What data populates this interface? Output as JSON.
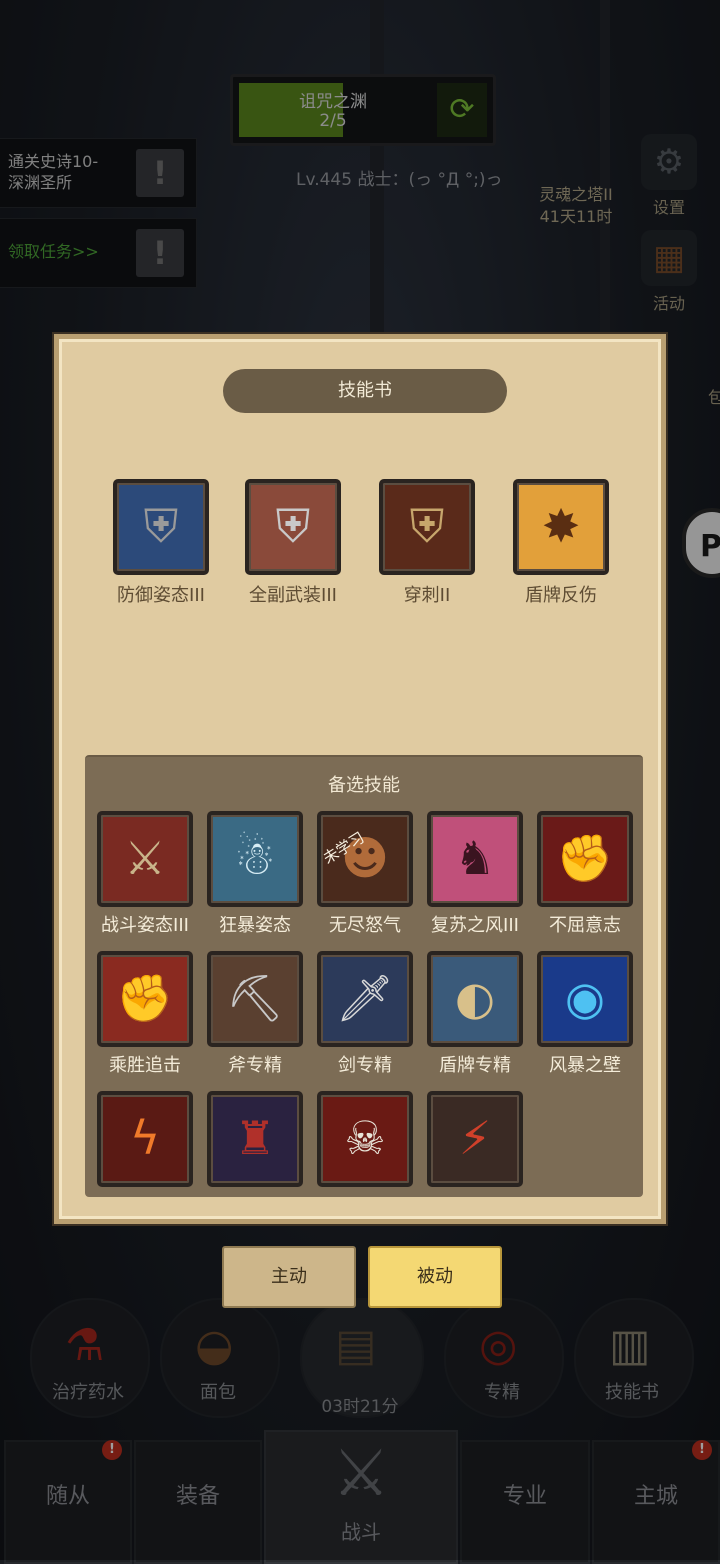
{
  "background": {
    "progress": {
      "title": "诅咒之渊",
      "count": "2/5",
      "fill_fraction": 0.42
    },
    "quests": [
      {
        "text_line1": "通关史诗10-",
        "text_line2": "深渊圣所"
      },
      {
        "text_line1": "领取任务>>",
        "text_line2": ""
      }
    ],
    "player_info": "Lv.445 战士：(っ °Д °;)っ",
    "tower": {
      "line1": "灵魂之塔II",
      "line2": "41天11时"
    },
    "side_buttons": {
      "settings": "设置",
      "activity": "活动",
      "bag_partial": "包"
    },
    "edge_badge": "P"
  },
  "panel": {
    "title": "技能书",
    "equipped": [
      {
        "name": "防御姿态III",
        "icon": "grey-shield-icon"
      },
      {
        "name": "全副武装III",
        "icon": "split-shield-icon"
      },
      {
        "name": "穿刺II",
        "icon": "pierced-shield-icon"
      },
      {
        "name": "盾牌反伤",
        "icon": "shield-burst-icon"
      }
    ],
    "candidates_title": "备选技能",
    "unlearned_label": "未学习",
    "candidates": [
      {
        "name": "战斗姿态III",
        "icon": "crossed-swords-icon",
        "unlearned": false
      },
      {
        "name": "狂暴姿态",
        "icon": "ice-warrior-icon",
        "unlearned": false
      },
      {
        "name": "无尽怒气",
        "icon": "roaring-beast-icon",
        "unlearned": true
      },
      {
        "name": "复苏之风III",
        "icon": "pink-demon-icon",
        "unlearned": false
      },
      {
        "name": "不屈意志",
        "icon": "red-fist-icon",
        "unlearned": false
      },
      {
        "name": "乘胜追击",
        "icon": "fist-punch-icon",
        "unlearned": false
      },
      {
        "name": "斧专精",
        "icon": "axe-helmet-icon",
        "unlearned": false
      },
      {
        "name": "剑专精",
        "icon": "sword-icon",
        "unlearned": false
      },
      {
        "name": "盾牌专精",
        "icon": "round-shield-icon",
        "unlearned": false
      },
      {
        "name": "风暴之壁",
        "icon": "blue-storm-icon",
        "unlearned": false
      },
      {
        "name": "",
        "icon": "lightning-slash-icon",
        "unlearned": false
      },
      {
        "name": "",
        "icon": "dark-warrior-icon",
        "unlearned": false
      },
      {
        "name": "",
        "icon": "bloody-beast-icon",
        "unlearned": false
      },
      {
        "name": "",
        "icon": "claw-strike-icon",
        "unlearned": false
      }
    ]
  },
  "tabs": {
    "active_label": "主动",
    "passive_label": "被动"
  },
  "hud": {
    "potion": "治疗药水",
    "bread": "面包",
    "timer": "03时21分",
    "mastery": "专精",
    "skillbook": "技能书"
  },
  "nav": {
    "followers": "随从",
    "equipment": "装备",
    "battle": "战斗",
    "profession": "专业",
    "city": "主城",
    "badge_mark": "!"
  }
}
